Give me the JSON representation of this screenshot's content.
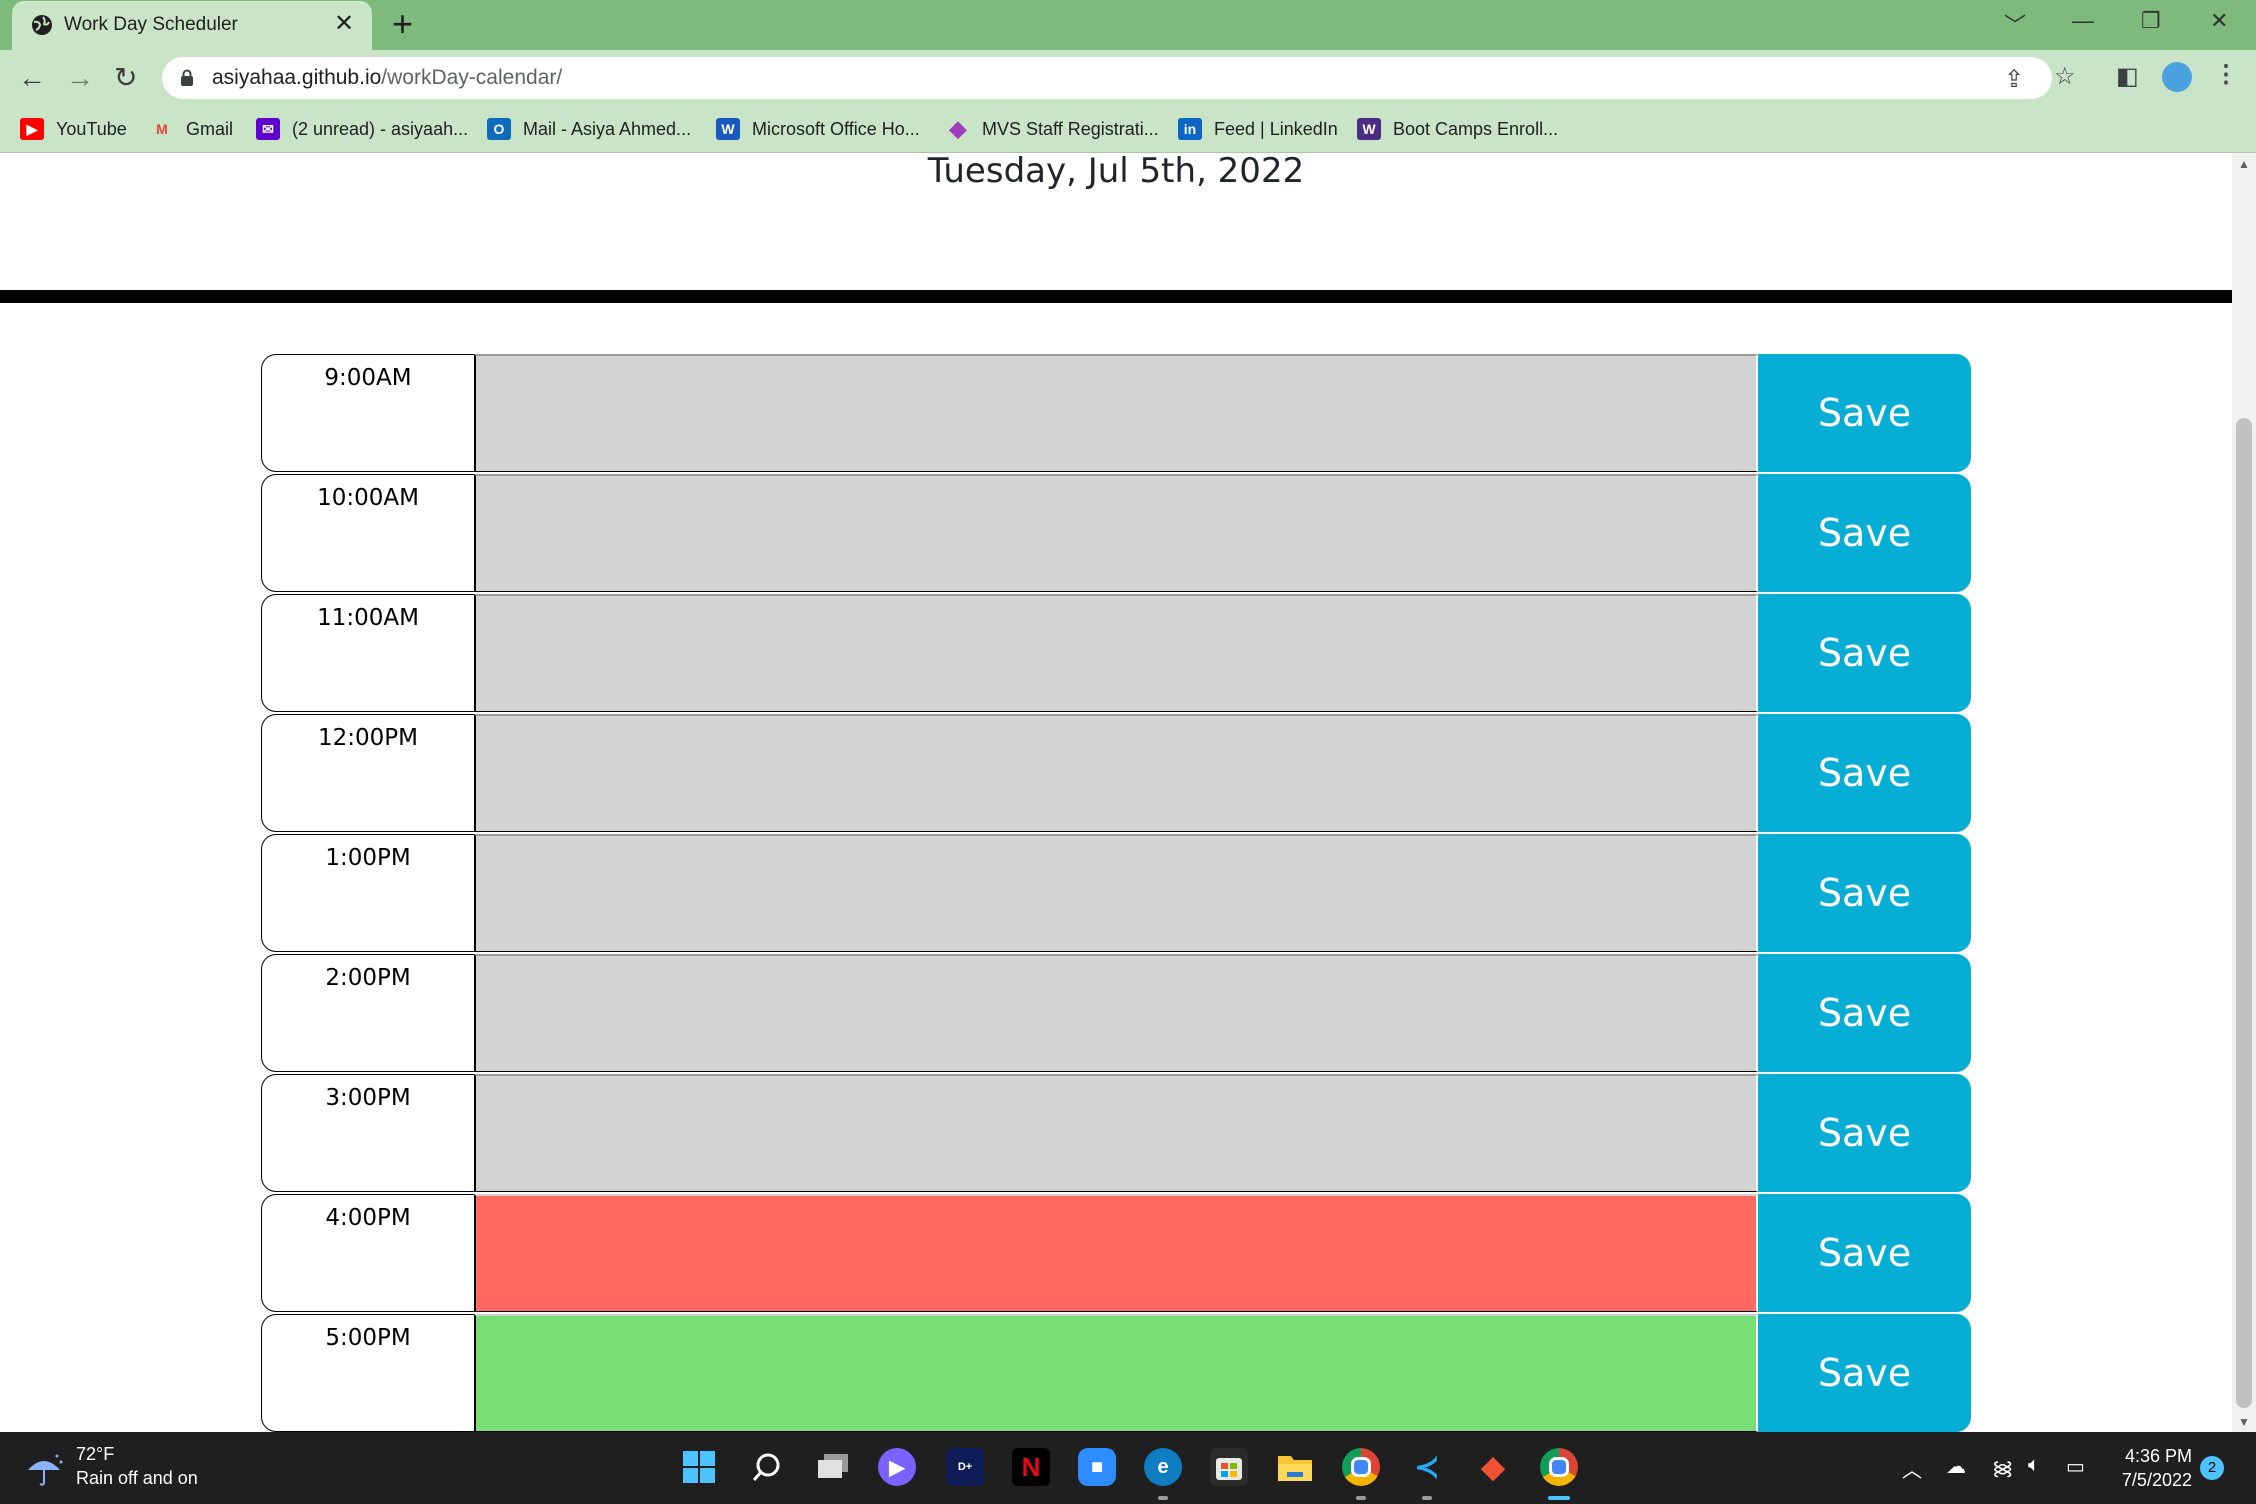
{
  "browser": {
    "tab_title": "Work Day Scheduler",
    "tab_close": "✕",
    "new_tab": "+",
    "url_host": "asiyahaa.github.io",
    "url_path": "/workDay-calendar/",
    "window_controls": [
      "﹀",
      "—",
      "❐",
      "✕"
    ],
    "bookmarks": [
      {
        "label": "YouTube",
        "icon": "youtube-icon",
        "color": "#ff0000"
      },
      {
        "label": "Gmail",
        "icon": "gmail-icon",
        "color": "#ea4335"
      },
      {
        "label": "(2 unread) - asiyaah...",
        "icon": "yahoo-mail-icon",
        "color": "#6001d2"
      },
      {
        "label": "Mail - Asiya Ahmed...",
        "icon": "outlook-icon",
        "color": "#0f6cbd"
      },
      {
        "label": "Microsoft Office Ho...",
        "icon": "word-icon",
        "color": "#185abd"
      },
      {
        "label": "MVS Staff Registrati...",
        "icon": "diamond-icon",
        "color": "#9b3fc0"
      },
      {
        "label": "Feed | LinkedIn",
        "icon": "linkedin-icon",
        "color": "#0a66c2"
      },
      {
        "label": "Boot Camps Enroll...",
        "icon": "uw-icon",
        "color": "#4b2e83"
      }
    ]
  },
  "page": {
    "date_text": "Tuesday, Jul 5th, 2022",
    "save_label": "Save",
    "colors": {
      "past": "#d3d3d3",
      "present": "#ff6961",
      "future": "#77dd77",
      "save": "#06aed5"
    },
    "hours": [
      {
        "label": "9:00AM",
        "state": "past"
      },
      {
        "label": "10:00AM",
        "state": "past"
      },
      {
        "label": "11:00AM",
        "state": "past"
      },
      {
        "label": "12:00PM",
        "state": "past"
      },
      {
        "label": "1:00PM",
        "state": "past"
      },
      {
        "label": "2:00PM",
        "state": "past"
      },
      {
        "label": "3:00PM",
        "state": "past"
      },
      {
        "label": "4:00PM",
        "state": "present"
      },
      {
        "label": "5:00PM",
        "state": "future"
      }
    ]
  },
  "taskbar": {
    "temperature": "72°F",
    "condition": "Rain off and on",
    "time": "4:36 PM",
    "date": "7/5/2022",
    "notification_count": "2"
  }
}
